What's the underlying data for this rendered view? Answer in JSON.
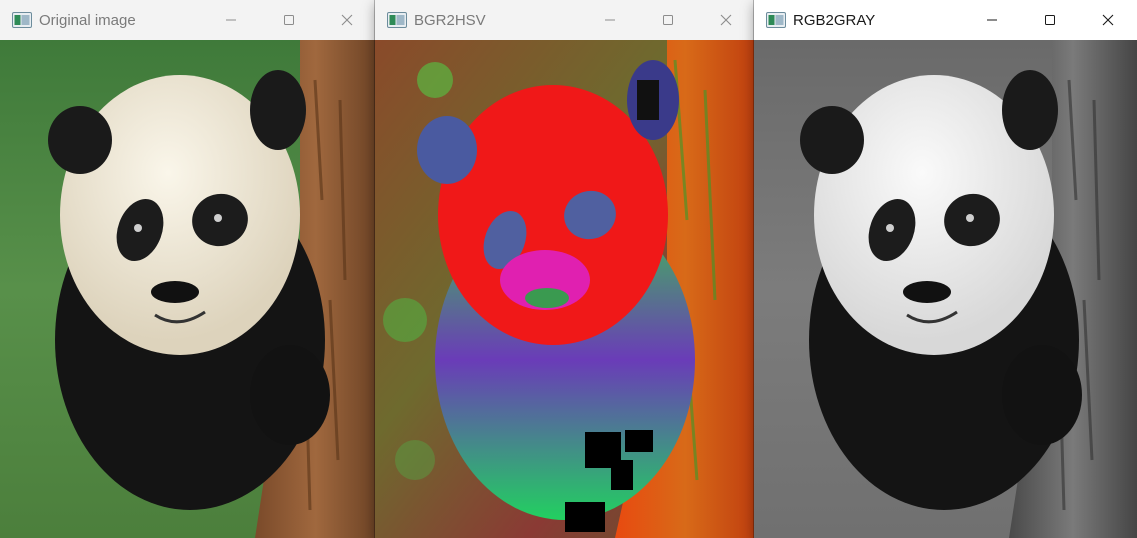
{
  "windows": [
    {
      "title": "Original image",
      "state": "inactive",
      "image_icon": "opencv-window-icon",
      "image_subject": "panda",
      "controls": [
        "minimize-icon",
        "maximize-icon",
        "close-icon"
      ]
    },
    {
      "title": "BGR2HSV",
      "state": "inactive",
      "image_icon": "opencv-window-icon",
      "image_subject": "panda",
      "controls": [
        "minimize-icon",
        "maximize-icon",
        "close-icon"
      ]
    },
    {
      "title": "RGB2GRAY",
      "state": "active",
      "image_icon": "opencv-window-icon",
      "image_subject": "panda",
      "controls": [
        "minimize-icon",
        "maximize-icon",
        "close-icon"
      ]
    }
  ],
  "colors": {
    "titlebar_active": "#ffffff",
    "titlebar_inactive": "#f3f3f3",
    "title_active": "#1a1a1a",
    "title_inactive": "#7a7a7a"
  }
}
